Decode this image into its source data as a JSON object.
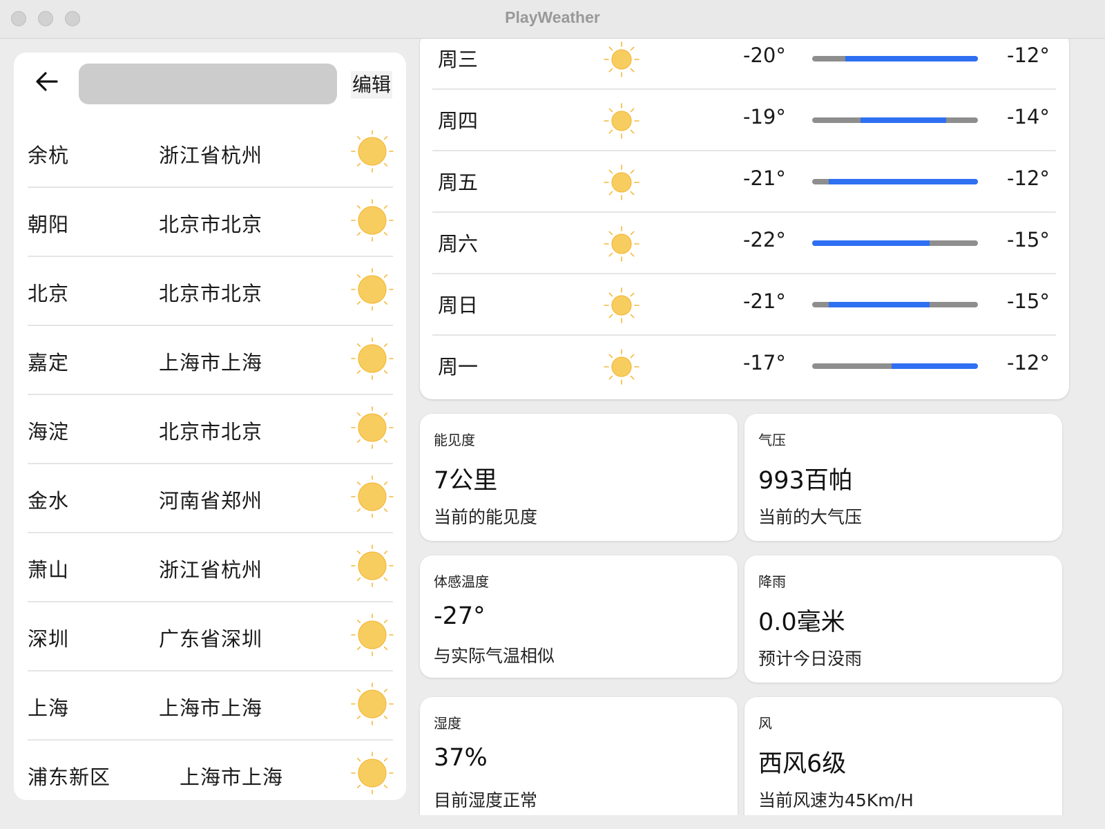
{
  "window": {
    "title": "PlayWeather"
  },
  "sidebar": {
    "search_placeholder": "",
    "edit_label": "编辑",
    "cities": [
      {
        "name": "余杭",
        "province": "浙江省杭州"
      },
      {
        "name": "朝阳",
        "province": "北京市北京"
      },
      {
        "name": "北京",
        "province": "北京市北京"
      },
      {
        "name": "嘉定",
        "province": "上海市上海"
      },
      {
        "name": "海淀",
        "province": "北京市北京"
      },
      {
        "name": "金水",
        "province": "河南省郑州"
      },
      {
        "name": "萧山",
        "province": "浙江省杭州"
      },
      {
        "name": "深圳",
        "province": "广东省深圳"
      },
      {
        "name": "上海",
        "province": "上海市上海"
      },
      {
        "name": "浦东新区",
        "province": "上海市上海"
      }
    ]
  },
  "forecast": {
    "days": [
      {
        "day": "周三",
        "low": "-20°",
        "high": "-12°",
        "range_start": 0.2,
        "range_end": 1.0
      },
      {
        "day": "周四",
        "low": "-19°",
        "high": "-14°",
        "range_start": 0.29,
        "range_end": 0.81
      },
      {
        "day": "周五",
        "low": "-21°",
        "high": "-12°",
        "range_start": 0.1,
        "range_end": 1.0
      },
      {
        "day": "周六",
        "low": "-22°",
        "high": "-15°",
        "range_start": 0.0,
        "range_end": 0.71
      },
      {
        "day": "周日",
        "low": "-21°",
        "high": "-15°",
        "range_start": 0.1,
        "range_end": 0.71
      },
      {
        "day": "周一",
        "low": "-17°",
        "high": "-12°",
        "range_start": 0.48,
        "range_end": 1.0
      }
    ]
  },
  "stats": {
    "visibility": {
      "label": "能见度",
      "value": "7公里",
      "desc": "当前的能见度"
    },
    "pressure": {
      "label": "气压",
      "value": "993百帕",
      "desc": "当前的大气压"
    },
    "feels_like": {
      "label": "体感温度",
      "value": "-27°",
      "desc": "与实际气温相似"
    },
    "rain": {
      "label": "降雨",
      "value": "0.0毫米",
      "desc": "预计今日没雨"
    },
    "humidity": {
      "label": "湿度",
      "value": "37%",
      "desc": "目前湿度正常"
    },
    "wind": {
      "label": "风",
      "value": "西风6级",
      "desc": "当前风速为45Km/H"
    }
  },
  "colors": {
    "accent_bar": "#2f6ff2",
    "sun": "#f8cd60",
    "sun_border": "#f3b93b",
    "card_bg": "#ffffff",
    "app_bg": "#ececec"
  },
  "icons": {
    "back": "arrow-left-icon",
    "weather": "sun-icon"
  }
}
